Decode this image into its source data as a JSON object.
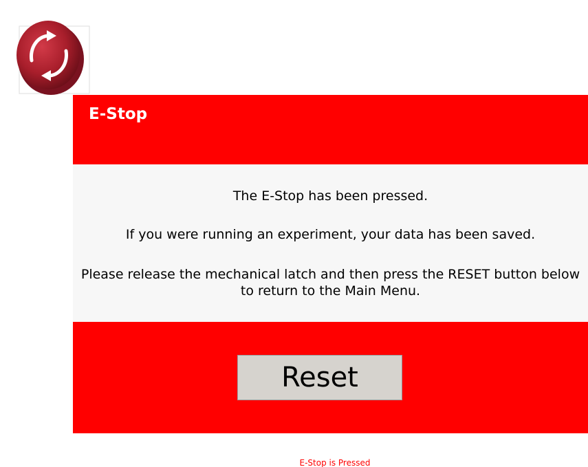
{
  "dialog": {
    "title": "E-Stop",
    "message_line_1": "The E-Stop has been pressed.",
    "message_line_2": "If you were running an experiment, your data has been saved.",
    "message_line_3": "Please release the mechanical latch and then press the RESET button below to return to the Main Menu."
  },
  "actions": {
    "reset_label": "Reset"
  },
  "status": {
    "text": "E-Stop is Pressed"
  },
  "icons": {
    "estop": "emergency-stop-button-icon"
  },
  "colors": {
    "alert_red": "#ff0000",
    "message_bg": "#f7f7f7",
    "button_bg": "#d6d3ce",
    "estop_red": "#a81e2b"
  }
}
